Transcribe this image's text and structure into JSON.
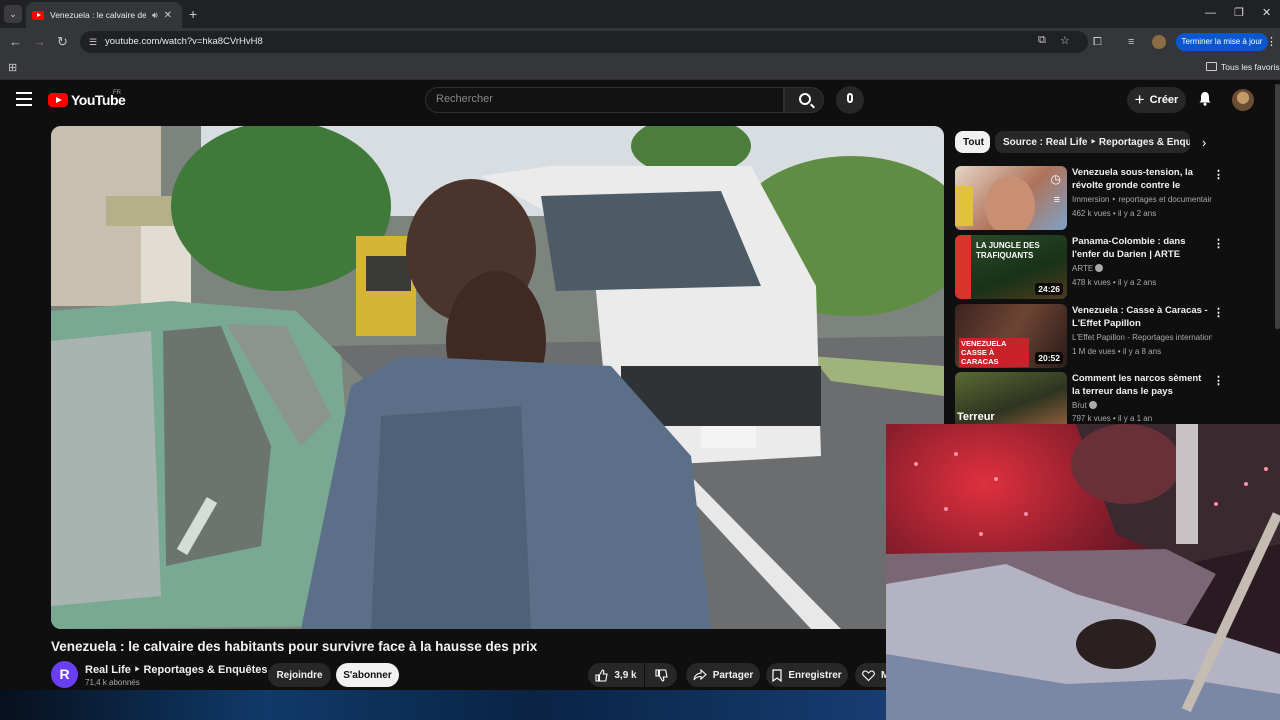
{
  "browser": {
    "tab_title": "Venezuela : le calvaire des h",
    "url": "youtube.com/watch?v=hka8CVrHvH8",
    "update_button": "Terminer la mise à jour",
    "bookmarks_label": "Tous les favoris"
  },
  "youtube": {
    "logo_text": "YouTube",
    "region": "FR",
    "search_placeholder": "Rechercher",
    "create_label": "Créer"
  },
  "video": {
    "title": "Venezuela : le calvaire des habitants pour survivre face à la hausse des prix",
    "channel_initial": "R",
    "channel_name": "Real Life ‣ Reportages & Enquêtes",
    "subscribers": "71,4 k abonnés",
    "join_label": "Rejoindre",
    "subscribe_label": "S'abonner",
    "likes": "3,9 k",
    "share_label": "Partager",
    "save_label": "Enregistrer",
    "thanks_label": "M"
  },
  "sidebar": {
    "chips": [
      "Tout",
      "Source : Real Life ‣ Reportages & Enquêtes"
    ],
    "recommendations": [
      {
        "title": "Venezuela sous-tension, la révolte gronde contre le régim...",
        "channel": "Immersion ‣ reportages et documentair...",
        "views": "462 k vues",
        "age": "il y a 2 ans",
        "duration": "",
        "thumb_text": ""
      },
      {
        "title": "Panama-Colombie : dans l'enfer du Darien | ARTE Reportage",
        "channel": "ARTE",
        "views": "478 k vues",
        "age": "il y a 2 ans",
        "duration": "24:26",
        "thumb_text": "LA JUNGLE DES TRAFIQUANTS"
      },
      {
        "title": "Venezuela : Casse à Caracas - L'Effet Papillon",
        "channel": "L'Effet Papillon - Reportages internationa...",
        "views": "1 M de vues",
        "age": "il y a 8 ans",
        "duration": "20:52",
        "thumb_text": "VENEZUELA CASSE À CARACAS"
      },
      {
        "title": "Comment les narcos sèment la terreur dans le pays",
        "channel": "Brut",
        "views": "797 k vues",
        "age": "il y a 1 an",
        "duration": "",
        "thumb_text": "Terreur"
      }
    ]
  },
  "colors": {
    "accent": "#ff0000",
    "update_blue": "#0b57d0",
    "background": "#0f0f0f"
  }
}
